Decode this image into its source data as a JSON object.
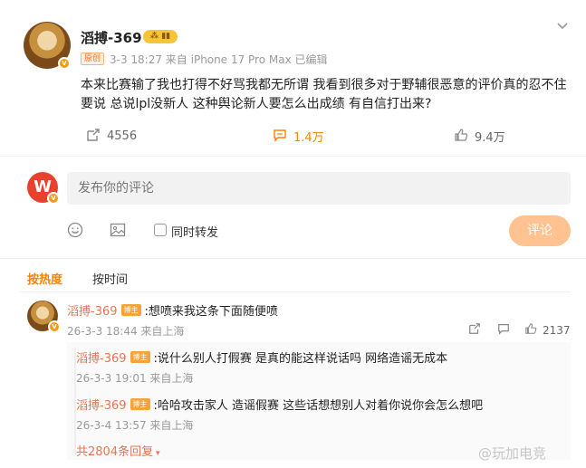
{
  "post": {
    "author": "滔搏-369",
    "vip_label": "⁂ ▮▮",
    "original_tag": "原创",
    "meta": "3-3 18:27  来自 iPhone 17 Pro Max 已编辑",
    "text": "本来比赛输了我也打得不好骂我都无所谓  我看到很多对于野辅很恶意的评价真的忍不住要说 总说lpl没新人 这种舆论新人要怎么出成绩 有自信打出来?",
    "stats": {
      "repost_count": "4556",
      "comment_count": "1.4万",
      "like_count": "9.4万"
    }
  },
  "compose": {
    "placeholder": "发布你的评论",
    "repost_label": "同时转发",
    "submit_label": "评论"
  },
  "sort": {
    "hot_label": "按热度",
    "time_label": "按时间"
  },
  "comment": {
    "author": "滔搏-369",
    "badge": "博主",
    "text": ":想喷来我这条下面随便喷",
    "meta": "26-3-3 18:44 来自上海",
    "like_count": "2137",
    "replies": [
      {
        "author": "滔搏-369",
        "badge": "博主",
        "text": ":说什么别人打假赛  是真的能这样说话吗  网络造谣无成本",
        "meta": "26-3-3 19:01 来自上海"
      },
      {
        "author": "滔搏-369",
        "badge": "博主",
        "text": ":哈哈攻击家人 造谣假赛  这些话想想别人对着你说你会怎么想吧",
        "meta": "26-3-4 13:57 来自上海"
      }
    ],
    "more_replies_label": "共2804条回复"
  },
  "watermark": "@玩加电竞",
  "colors": {
    "accent": "#ff8200",
    "name": "#eb7350",
    "submit_disabled": "#ffc290"
  }
}
